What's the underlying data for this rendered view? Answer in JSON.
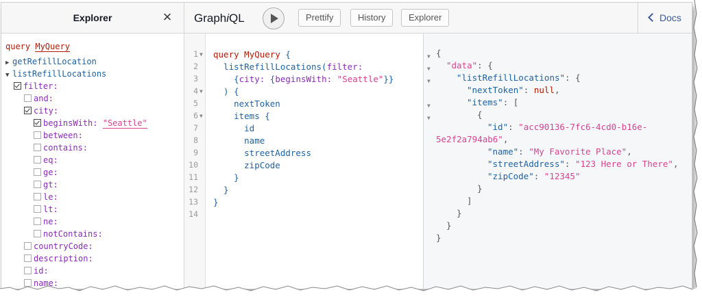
{
  "explorer": {
    "title": "Explorer",
    "close_icon": "×",
    "query_keyword": "query",
    "query_name": "MyQuery",
    "nodes": [
      {
        "label": "getRefillLocation",
        "kind": "field",
        "arrow": "▶"
      },
      {
        "label": "listRefillLocations",
        "kind": "field",
        "arrow": "▼"
      },
      {
        "label": "filter:",
        "kind": "arg",
        "checked": true
      },
      {
        "label": "and:",
        "kind": "arg",
        "checked": false
      },
      {
        "label": "city:",
        "kind": "arg",
        "checked": true
      },
      {
        "label": "beginsWith:",
        "kind": "arg",
        "checked": true,
        "value": "\"Seattle\""
      },
      {
        "label": "between:",
        "kind": "arg",
        "checked": false
      },
      {
        "label": "contains:",
        "kind": "arg",
        "checked": false
      },
      {
        "label": "eq:",
        "kind": "arg",
        "checked": false
      },
      {
        "label": "ge:",
        "kind": "arg",
        "checked": false
      },
      {
        "label": "gt:",
        "kind": "arg",
        "checked": false
      },
      {
        "label": "le:",
        "kind": "arg",
        "checked": false
      },
      {
        "label": "lt:",
        "kind": "arg",
        "checked": false
      },
      {
        "label": "ne:",
        "kind": "arg",
        "checked": false
      },
      {
        "label": "notContains:",
        "kind": "arg",
        "checked": false
      },
      {
        "label": "countryCode:",
        "kind": "arg",
        "checked": false
      },
      {
        "label": "description:",
        "kind": "arg",
        "checked": false
      },
      {
        "label": "id:",
        "kind": "arg",
        "checked": false
      },
      {
        "label": "name:",
        "kind": "arg",
        "checked": false
      }
    ]
  },
  "toolbar": {
    "brand_prefix": "Graph",
    "brand_italic": "i",
    "brand_suffix": "QL",
    "run_icon": "play-icon",
    "buttons": [
      "Prettify",
      "History",
      "Explorer"
    ],
    "docs_label": "Docs"
  },
  "editor": {
    "line_numbers": [
      "1",
      "2",
      "3",
      "4",
      "5",
      "6",
      "7",
      "8",
      "9",
      "10",
      "11",
      "12",
      "13",
      "14"
    ],
    "lines": [
      "query MyQuery {",
      "  listRefillLocations(filter:",
      "    {city: {beginsWith: \"Seattle\"}}",
      "  ) {",
      "    nextToken",
      "    items {",
      "      id",
      "      name",
      "      streetAddress",
      "      zipCode",
      "    }",
      "  }",
      "}",
      ""
    ]
  },
  "result": {
    "data_key": "\"data\"",
    "list_key": "\"listRefillLocations\"",
    "next_token_key": "\"nextToken\"",
    "next_token_value": "null",
    "items_key": "\"items\"",
    "id_key": "\"id\"",
    "id_value_part1": "\"acc90136-7fc6-4cd0-b16e-",
    "id_value_part2": "5e2f2a794ab6\"",
    "name_key": "\"name\"",
    "name_value": "\"My Favorite Place\"",
    "street_key": "\"streetAddress\"",
    "street_value": "\"123 Here or There\"",
    "zip_key": "\"zipCode\"",
    "zip_value": "\"12345\""
  },
  "colors": {
    "keyword": "#b11a04",
    "field": "#1f61a0",
    "argument": "#8b2bb9",
    "string": "#d64292",
    "docs_link": "#3B5998"
  }
}
